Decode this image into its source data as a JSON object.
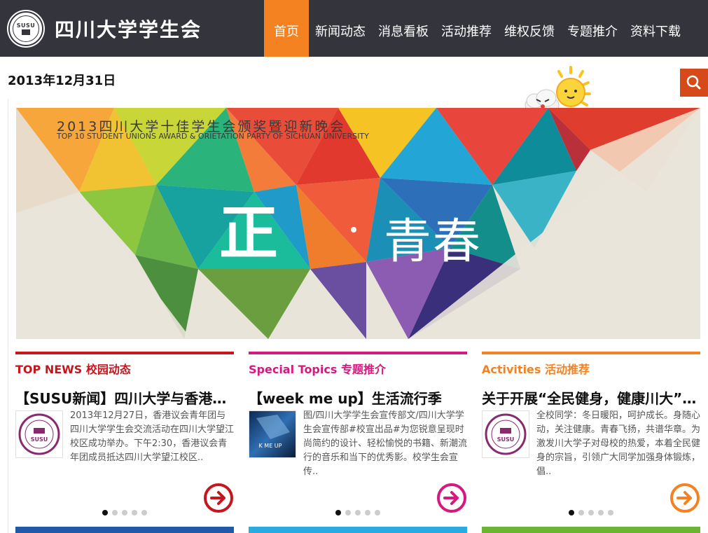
{
  "header": {
    "logo_letters": "SUSU",
    "site_title": "四川大学学生会",
    "nav": [
      {
        "label": "首页"
      },
      {
        "label": "新闻动态"
      },
      {
        "label": "消息看板"
      },
      {
        "label": "活动推荐"
      },
      {
        "label": "维权反馈"
      },
      {
        "label": "专题推介"
      },
      {
        "label": "资料下载"
      }
    ],
    "accent": "#f58220"
  },
  "date": "2013年12月31日",
  "banner": {
    "title": "2013四川大学十佳学生会颁奖暨迎新晚会",
    "subtitle": "TOP 10 STUDENT UNIONS AWARD & ORIETATION PARTY OF SICHUAN UNIVERSITY",
    "big_char": "正",
    "big_text": "青春"
  },
  "cards": [
    {
      "category": "TOP NEWS 校园动态",
      "color": "#c4161c",
      "headline": "【SUSU新闻】四川大学与香港议会青年团交流",
      "excerpt": "2013年12月27日，香港议会青年团与四川大学学生会交流活动在四川大学望江校区成功举办。下午2:30，香港议会青年团成员抵达四川大学望江校区..",
      "thumb": "susu-logo"
    },
    {
      "category": "Special Topics 专题推介",
      "color": "#d6197f",
      "headline": "【week me up】生活流行季",
      "excerpt": "图/四川大学学生会宣传部文/四川大学学生会宣传部#校宣出品#为您锐意呈现时尚简约的设计、轻松愉悦的书籍、新潮流行的音乐和当下的优秀影。校学生会宣传..",
      "thumb": "wake-me-up"
    },
    {
      "category": "Activities 活动推荐",
      "color": "#f58220",
      "headline": "关于开展“全民健身，健康川大”活动的通知",
      "excerpt": "全校同学：冬日暖阳，呵护成长。身随心动，关注健康。青春飞扬，共谱华章。为激发川大学子对母校的热爱，本着全民健身的宗旨，引领广大同学加强身体锻炼，倡..",
      "thumb": "susu-logo"
    }
  ],
  "bottom_colors": [
    "#1e5aa8",
    "#29abe2",
    "#6ab533"
  ]
}
